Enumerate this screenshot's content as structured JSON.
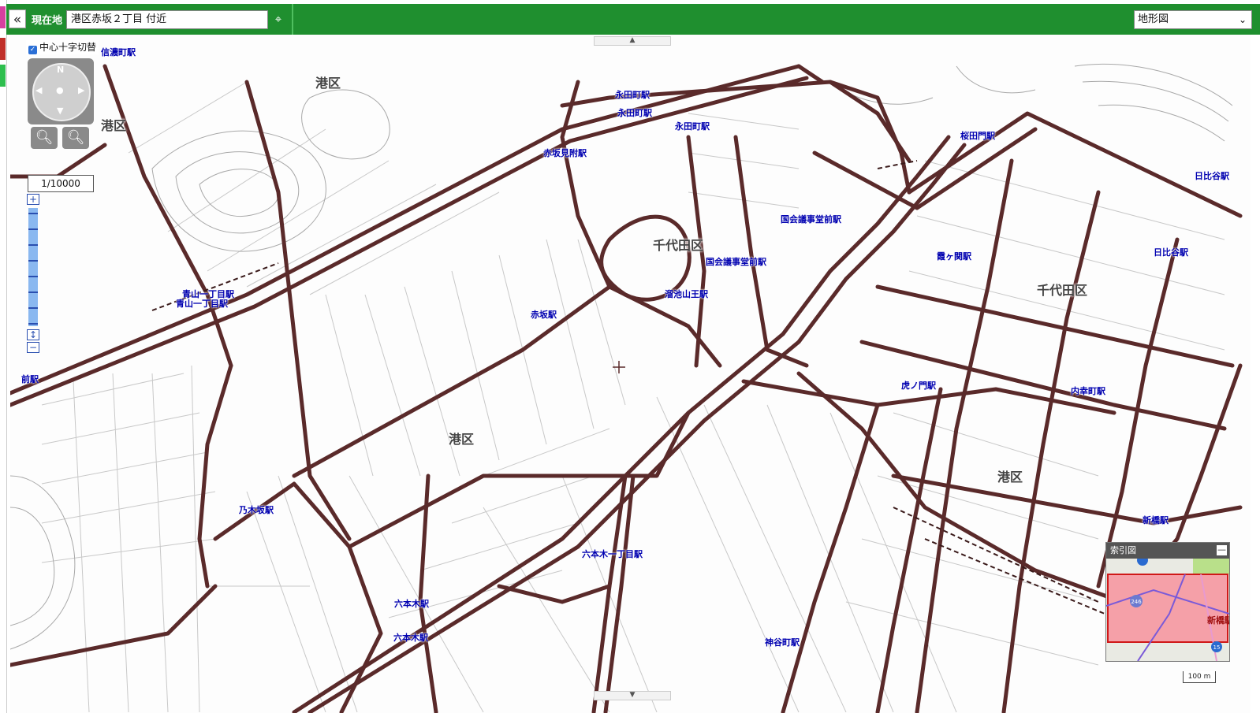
{
  "toolbar": {
    "collapse_icon": "double-chevron-left-icon",
    "collapse_label": "«",
    "location_label": "現在地",
    "location_value": "港区赤坂２丁目 付近",
    "crosshair_label": "⌖",
    "map_type_selected": "地形図"
  },
  "map_controls": {
    "crosshair_toggle_label": "中心十字切替",
    "compass_label": "N",
    "zoom_in_label": "+",
    "zoom_out_label": "−",
    "scale_denominator": "1/10000",
    "slider_plus": "+",
    "slider_minus": "−",
    "zoom_level_fraction": 0.87
  },
  "ward_labels": [
    {
      "text": "港区"
    },
    {
      "text": "港区"
    },
    {
      "text": "千代田区"
    },
    {
      "text": "千代田区"
    },
    {
      "text": "港区"
    },
    {
      "text": "港区"
    }
  ],
  "stations": [
    {
      "text": "信濃町駅"
    },
    {
      "text": "永田町駅"
    },
    {
      "text": "永田町駅"
    },
    {
      "text": "永田町駅"
    },
    {
      "text": "桜田門駅"
    },
    {
      "text": "日比谷駅"
    },
    {
      "text": "赤坂見附駅"
    },
    {
      "text": "国会議事堂前駅"
    },
    {
      "text": "国会議事堂前駅"
    },
    {
      "text": "霞ヶ関駅"
    },
    {
      "text": "日比谷駅"
    },
    {
      "text": "青山一丁目駅"
    },
    {
      "text": "青山一丁目駅"
    },
    {
      "text": "溜池山王駅"
    },
    {
      "text": "赤坂駅"
    },
    {
      "text": "前駅"
    },
    {
      "text": "虎ノ門駅"
    },
    {
      "text": "内幸町駅"
    },
    {
      "text": "乃木坂駅"
    },
    {
      "text": "新橋駅"
    },
    {
      "text": "六本木一丁目駅"
    },
    {
      "text": "六本木駅"
    },
    {
      "text": "六本木駅"
    },
    {
      "text": "神谷町駅"
    }
  ],
  "index_map": {
    "title": "索引図",
    "minimize_label": "—",
    "route_246": "246",
    "route_15": "15",
    "place": "新橋駅"
  },
  "scale_bar": "100 m",
  "colors": {
    "toolbar": "#1f8f2f",
    "road": "#5a2a2a",
    "station": "#0000b0",
    "index_area": "#f5a0a8"
  }
}
